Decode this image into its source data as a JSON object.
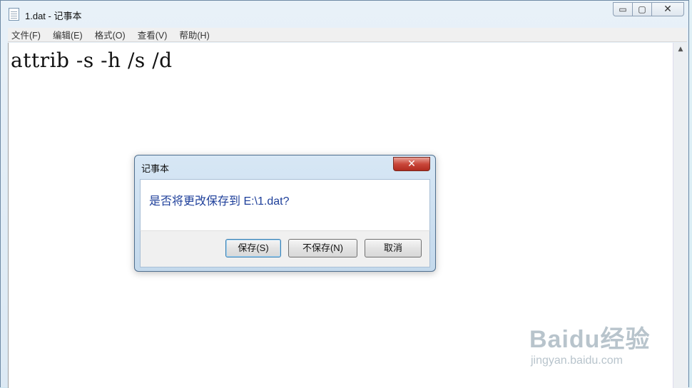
{
  "window": {
    "title": "1.dat - 记事本",
    "controls": {
      "minimize": "▭",
      "maximize": "▢",
      "close": "✕"
    }
  },
  "menu": {
    "items": [
      "文件(F)",
      "编辑(E)",
      "格式(O)",
      "查看(V)",
      "帮助(H)"
    ]
  },
  "editor": {
    "content": "attrib -s -h /s /d",
    "scroll_up_glyph": "▲"
  },
  "dialog": {
    "title": "记事本",
    "close_glyph": "✕",
    "message": "是否将更改保存到 E:\\1.dat?",
    "buttons": {
      "save": "保存(S)",
      "dont_save": "不保存(N)",
      "cancel": "取消"
    }
  },
  "watermark": {
    "brand": "Baidu经验",
    "url": "jingyan.baidu.com"
  },
  "colors": {
    "message_text": "#1e3f9a",
    "dialog_close_red": "#c9473a"
  }
}
